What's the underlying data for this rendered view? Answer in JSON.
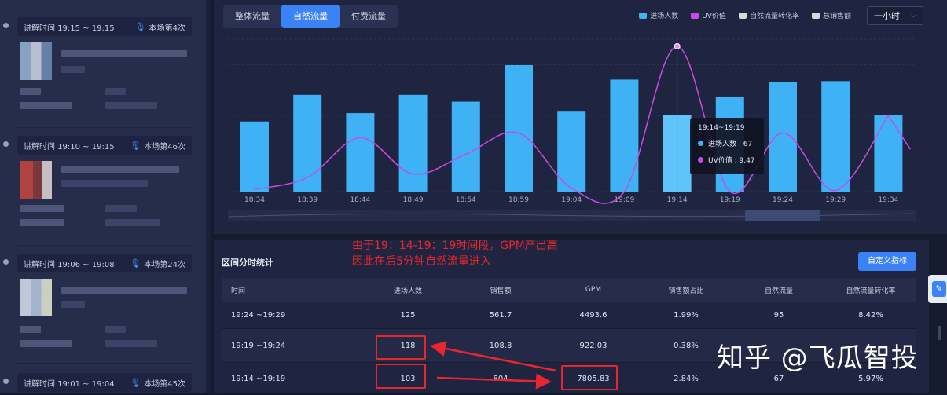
{
  "sidebar": {
    "segments": [
      {
        "time": "讲解时间 19:15 ~ 19:15",
        "count": "本场第4次"
      },
      {
        "time": "讲解时间 19:10 ~ 19:15",
        "count": "本场第46次"
      },
      {
        "time": "讲解时间 19:06 ~ 19:08",
        "count": "本场第24次"
      },
      {
        "time": "讲解时间 19:01 ~ 19:04",
        "count": "本场第45次"
      }
    ]
  },
  "chart_panel": {
    "tabs": [
      "整体流量",
      "自然流量",
      "付费流量"
    ],
    "active_tab": "自然流量",
    "legend": [
      {
        "label": "进场人数",
        "color": "#3fb1f5"
      },
      {
        "label": "UV价值",
        "color": "#c54ee0"
      },
      {
        "label": "自然流量转化率",
        "color": "#d9d9d9"
      },
      {
        "label": "总销售额",
        "color": "#d9d9d9"
      }
    ],
    "range_select": "一小时",
    "tooltip": {
      "title": "19:14~19:19",
      "row1": "进场人数 : 67",
      "row2": "UV价值 : 9.47"
    }
  },
  "chart_data": {
    "type": "bar",
    "categories": [
      "18:34",
      "18:39",
      "18:44",
      "18:49",
      "18:54",
      "18:59",
      "19:04",
      "19:09",
      "19:14",
      "19:19",
      "19:24",
      "19:29",
      "19:34"
    ],
    "series": [
      {
        "name": "进场人数",
        "type": "bar",
        "color": "#3fb1f5",
        "values": [
          92,
          127,
          103,
          127,
          118,
          166,
          106,
          147,
          101,
          124,
          144,
          145,
          100
        ]
      },
      {
        "name": "UV价值",
        "type": "line",
        "color": "#c54ee0",
        "values": [
          0.2,
          1.2,
          4.6,
          1.5,
          3.2,
          5.0,
          0.3,
          0.0,
          12.4,
          0.0,
          5.0,
          0.1,
          6.5
        ]
      }
    ],
    "ylim_bar": [
      0,
      200
    ],
    "ylim_line": [
      0,
      13
    ],
    "grid": true,
    "legend_position": "top-right"
  },
  "table_panel": {
    "title": "区间分时统计",
    "custom_button": "自定义指标",
    "columns": [
      "时间",
      "进场人数",
      "销售额",
      "GPM",
      "销售额占比",
      "自然流量",
      "自然流量转化率"
    ],
    "rows": [
      [
        "19:24 ~19:29",
        "125",
        "561.7",
        "4493.6",
        "1.99%",
        "95",
        "8.42%"
      ],
      [
        "19:19 ~19:24",
        "118",
        "108.8",
        "922.03",
        "0.38%",
        "",
        ""
      ],
      [
        "19:14 ~19:19",
        "103",
        "804",
        "7805.83",
        "2.84%",
        "67",
        "5.97%"
      ]
    ]
  },
  "annotation": {
    "line1": "由于19：14-19：19时间段，GPM产出高",
    "line2": "因此在后5分钟自然流量进入"
  },
  "watermark": "知乎 @飞瓜智投"
}
